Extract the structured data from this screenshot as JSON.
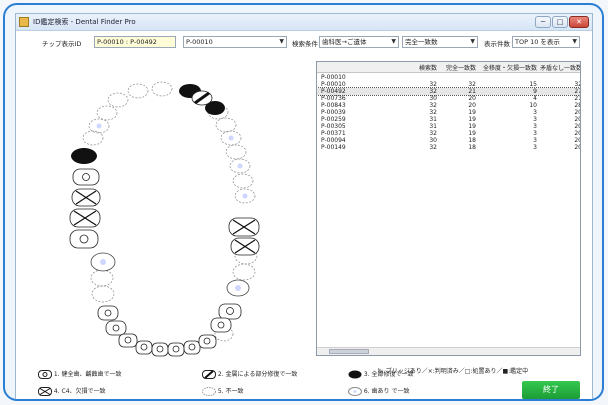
{
  "window": {
    "title": "ID鑑定検索 - Dental Finder Pro",
    "minimize": "─",
    "maximize": "□",
    "close": "✕"
  },
  "toolbar": {
    "chip_id_label": "チップ表示ID",
    "chip_id_value": "P-00010 : P-00492",
    "id_select": "P-00010",
    "search_condition_label": "検索条件",
    "condition_select_1": "歯科医→ご遺体",
    "condition_select_2": "完全一致数",
    "display_count_label": "表示件数",
    "display_count_select": "TOP 10 を表示"
  },
  "results": {
    "columns": [
      "",
      "検索数",
      "完全一致数",
      "全移度・欠損一致数",
      "矛盾なし一致数"
    ],
    "rows": [
      [
        "P-00010",
        "",
        "",
        "",
        ""
      ],
      [
        "P-00010",
        "32",
        "32",
        "15",
        "32"
      ],
      [
        "P-00492",
        "32",
        "21",
        "9",
        "27"
      ],
      [
        "P-00736",
        "30",
        "20",
        "4",
        "21"
      ],
      [
        "P-00843",
        "32",
        "20",
        "10",
        "28"
      ],
      [
        "P-00039",
        "32",
        "19",
        "3",
        "20"
      ],
      [
        "P-00259",
        "31",
        "19",
        "3",
        "20"
      ],
      [
        "P-00305",
        "31",
        "19",
        "3",
        "20"
      ],
      [
        "P-00371",
        "32",
        "19",
        "3",
        "20"
      ],
      [
        "P-00094",
        "30",
        "18",
        "3",
        "20"
      ],
      [
        "P-00149",
        "32",
        "18",
        "3",
        "20"
      ]
    ],
    "selected_row_index": 2
  },
  "note": "b: ブリッジあり／×:判明済み／□:処置あり／■:鑑定中",
  "legend": {
    "items": [
      {
        "label": "1. 健全歯、齲蝕歯で一致",
        "icon": "healthy-tooth-icon"
      },
      {
        "label": "2. 金属による部分修復で一致",
        "icon": "partial-metal-icon"
      },
      {
        "label": "3. 全部修復で一致",
        "icon": "full-restoration-icon"
      },
      {
        "label": "4. C4、欠損で一致",
        "icon": "missing-tooth-icon"
      },
      {
        "label": "5. 不一致",
        "icon": "mismatch-icon"
      },
      {
        "label": "6. 歯あり で一致",
        "icon": "tooth-present-icon"
      }
    ]
  },
  "end_button": "終了",
  "colors": {
    "frame_border": "#2a7fd4",
    "end_button": "#22a83c",
    "selected_row": "#e6e6e6"
  }
}
